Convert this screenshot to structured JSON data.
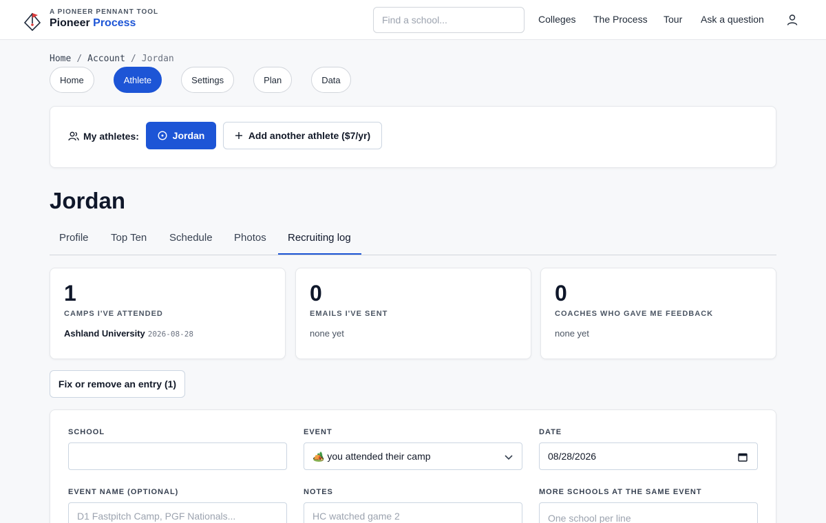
{
  "brand": {
    "tagline": "A PIONEER PENNANT TOOL",
    "name_prefix": "Pioneer",
    "name_accent": "Process"
  },
  "search": {
    "placeholder": "Find a school..."
  },
  "nav": [
    "Colleges",
    "The Process",
    "Tour",
    "Ask a question"
  ],
  "breadcrumb": [
    "Home",
    "Account",
    "Jordan"
  ],
  "pills": [
    "Home",
    "Athlete",
    "Settings",
    "Plan",
    "Data"
  ],
  "athletes": {
    "label": "My athletes:",
    "current": "Jordan",
    "add": "Add another athlete ($7/yr)"
  },
  "title": "Jordan",
  "subtabs": [
    "Profile",
    "Top Ten",
    "Schedule",
    "Photos",
    "Recruiting log"
  ],
  "stats": [
    {
      "value": "1",
      "label": "CAMPS I'VE ATTENDED",
      "detail_name": "Ashland University",
      "detail_date": "2026-08-28"
    },
    {
      "value": "0",
      "label": "EMAILS I'VE SENT",
      "detail": "none yet"
    },
    {
      "value": "0",
      "label": "COACHES WHO GAVE ME FEEDBACK",
      "detail": "none yet"
    }
  ],
  "fix_button": "Fix or remove an entry (1)",
  "form": {
    "school_label": "SCHOOL",
    "school_value": "",
    "event_label": "EVENT",
    "event_value": "🏕️ you attended their camp",
    "date_label": "DATE",
    "date_value": "08/28/2026",
    "event_name_label": "EVENT NAME (OPTIONAL)",
    "event_name_placeholder": "D1 Fastpitch Camp, PGF Nationals...",
    "notes_label": "NOTES",
    "notes_placeholder": "HC watched game 2",
    "more_label": "MORE SCHOOLS AT THE SAME EVENT",
    "more_placeholder": "One school per line"
  },
  "colors": {
    "accent": "#1d55d6",
    "logo_red": "#d93a3a"
  }
}
